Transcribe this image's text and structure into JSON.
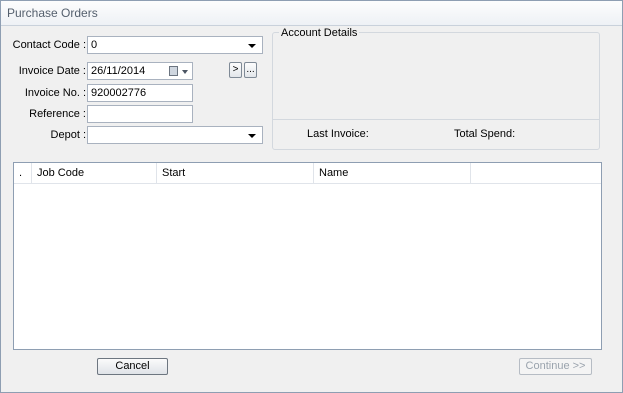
{
  "window": {
    "title": "Purchase Orders"
  },
  "form": {
    "contact_code_label": "Contact Code :",
    "contact_code_value": "0",
    "invoice_date_label": "Invoice Date :",
    "invoice_date_value": "26/11/2014",
    "invoice_no_label": "Invoice No. :",
    "invoice_no_value": "920002776",
    "reference_label": "Reference :",
    "reference_value": "",
    "depot_label": "Depot :",
    "depot_value": "",
    "next_button_label": ">",
    "ellipsis_button_label": "..."
  },
  "account_details": {
    "legend": "Account Details",
    "last_invoice_label": "Last Invoice:",
    "total_spend_label": "Total Spend:"
  },
  "grid": {
    "columns": [
      ".",
      "Job Code",
      "Start",
      "Name",
      ""
    ],
    "rows": []
  },
  "footer": {
    "cancel_label": "Cancel",
    "continue_label": "Continue >>"
  },
  "colors": {
    "window_border": "#8e9eb2",
    "title_text": "#545f6d",
    "disabled_text": "#9aa3ad"
  },
  "icons": {
    "calendar": "calendar-icon",
    "dropdown": "chevron-down-icon"
  }
}
